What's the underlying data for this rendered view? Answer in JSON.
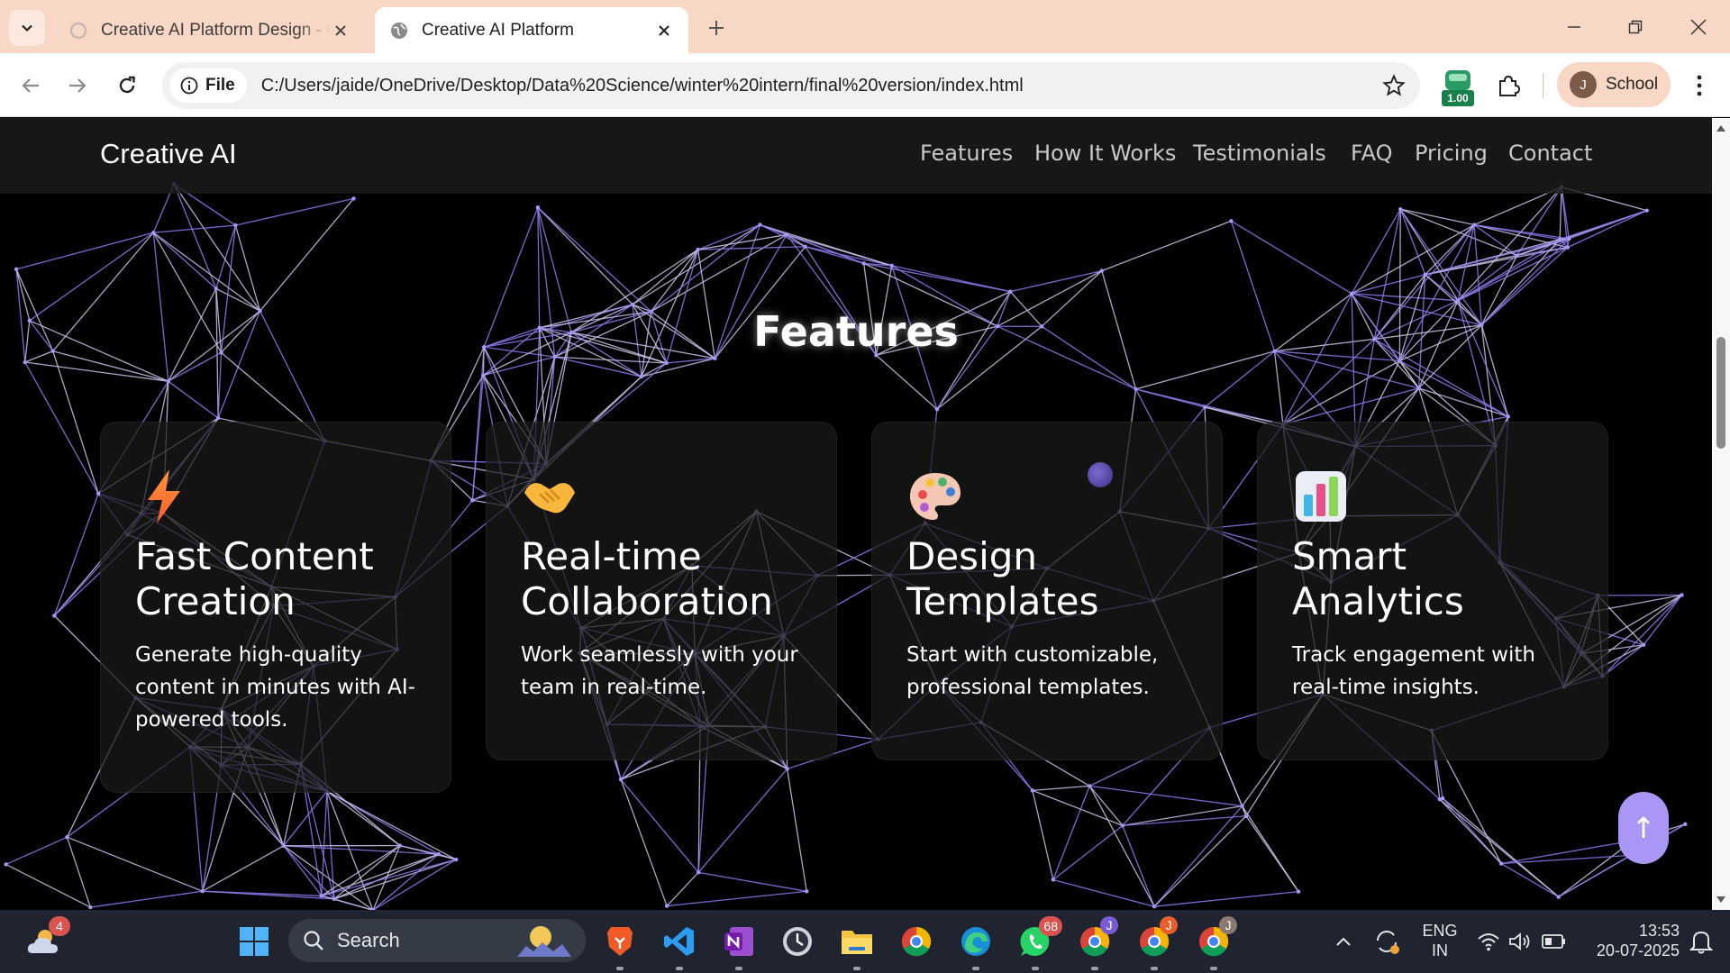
{
  "browser": {
    "tabs": [
      {
        "title": "Creative AI Platform Design - G",
        "active": false
      },
      {
        "title": "Creative AI Platform",
        "active": true
      }
    ],
    "address_chip": "File",
    "url": "C:/Users/jaide/OneDrive/Desktop/Data%20Science/winter%20intern/final%20version/index.html",
    "extension_badge": "1.00",
    "profile": {
      "initial": "J",
      "name": "School"
    }
  },
  "site": {
    "brand": "Creative AI",
    "nav": [
      "Features",
      "How It Works",
      "Testimonials",
      "FAQ",
      "Pricing",
      "Contact"
    ],
    "section_title": "Features",
    "features": [
      {
        "icon": "lightning-icon",
        "title": "Fast Content Creation",
        "description": "Generate high-quality content in minutes with AI-powered tools."
      },
      {
        "icon": "handshake-icon",
        "title": "Real-time Collaboration",
        "description": "Work seamlessly with your team in real-time."
      },
      {
        "icon": "palette-icon",
        "title": "Design Templates",
        "description": "Start with customizable, professional templates."
      },
      {
        "icon": "bar-chart-icon",
        "title": "Smart Analytics",
        "description": "Track engagement with real-time insights."
      }
    ],
    "scroll_top_glyph": "↑",
    "accent": "#a996f5"
  },
  "taskbar": {
    "weather_badge": "4",
    "search_label": "Search",
    "whatsapp_badge": "68",
    "chrome_profile_badges": [
      "J",
      "J",
      "J"
    ],
    "language": "ENG",
    "region": "IN",
    "time": "13:53",
    "date": "20-07-2025"
  }
}
